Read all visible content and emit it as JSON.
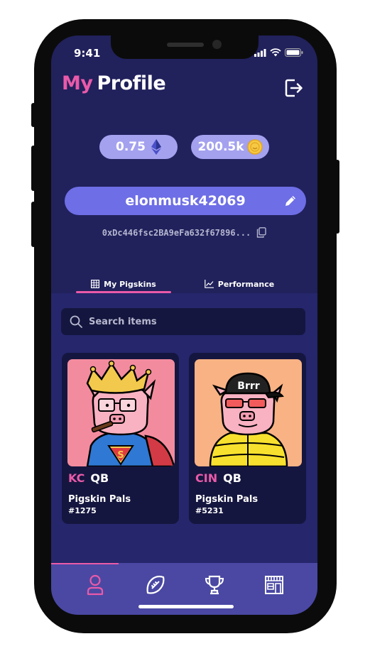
{
  "status_bar": {
    "time": "9:41"
  },
  "header": {
    "title_accent": "My",
    "title": "Profile"
  },
  "balances": [
    {
      "value": "0.75",
      "icon": "ethereum-icon"
    },
    {
      "value": "200.5k",
      "icon": "coin-icon"
    }
  ],
  "profile": {
    "username": "elonmusk42069",
    "wallet_address": "0xDc446fsc2BA9eFa632f67896..."
  },
  "tabs": [
    {
      "label": "My Pigskins",
      "icon": "grid-icon",
      "active": true
    },
    {
      "label": "Performance",
      "icon": "chart-line-icon",
      "active": false
    }
  ],
  "search": {
    "placeholder": "Search items"
  },
  "cards": [
    {
      "team": "KC",
      "position": "QB",
      "collection": "Pigskin Pals",
      "number": "#1275",
      "art_bg": "#f38b9e"
    },
    {
      "team": "CIN",
      "position": "QB",
      "collection": "Pigskin Pals",
      "number": "#5231",
      "art_bg": "#f8b284",
      "cap_text": "Brrr"
    }
  ],
  "bottom_nav": [
    "profile-icon",
    "football-icon",
    "trophy-icon",
    "store-icon"
  ],
  "colors": {
    "accent": "#ea5aa9",
    "background": "#21215c",
    "pill": "#a4a1ef",
    "username_bar": "#6e6ee6",
    "nav": "#4a48a3"
  }
}
